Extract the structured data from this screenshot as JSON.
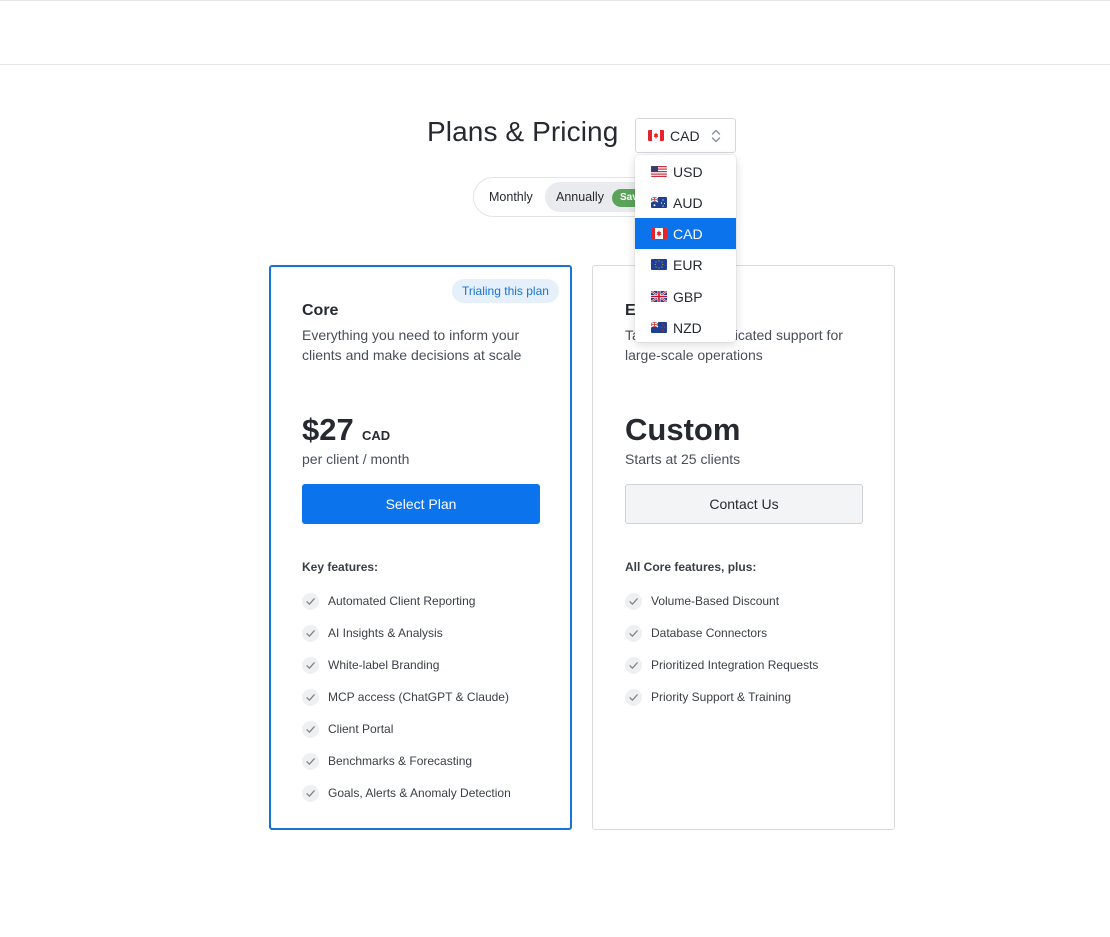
{
  "header": {
    "title": "Plans & Pricing"
  },
  "currency": {
    "selected": "CAD",
    "options": [
      "USD",
      "AUD",
      "CAD",
      "EUR",
      "GBP",
      "NZD"
    ]
  },
  "billing": {
    "monthly_label": "Monthly",
    "annually_label": "Annually",
    "save_badge": "Save"
  },
  "plans": {
    "core": {
      "badge": "Trialing this plan",
      "name": "Core",
      "description": "Everything you need to inform your clients and make decisions at scale",
      "price": "$27",
      "price_unit": "CAD",
      "price_sub": "per client / month",
      "cta": "Select Plan",
      "features_heading": "Key features:",
      "features": [
        "Automated Client Reporting",
        "AI Insights & Analysis",
        "White-label Branding",
        "MCP access (ChatGPT & Claude)",
        "Client Portal",
        "Benchmarks & Forecasting",
        "Goals, Alerts & Anomaly Detection"
      ]
    },
    "enterprise": {
      "name": "E",
      "description": "Ta           with dedicated support for large-scale operations",
      "price": "Custom",
      "price_sub": "Starts at 25 clients",
      "cta": "Contact Us",
      "features_heading": "All Core features, plus:",
      "features": [
        "Volume-Based Discount",
        "Database Connectors",
        "Prioritized Integration Requests",
        "Priority Support & Training"
      ]
    }
  },
  "colors": {
    "primary": "#0b73ec",
    "card_selected_border": "#1773d6",
    "save_green": "#5ba35a",
    "text": "#262a30"
  },
  "icons": {
    "check": "check-icon",
    "selector": "chevron-updown-icon",
    "flags": [
      "us-flag-icon",
      "au-flag-icon",
      "ca-flag-icon",
      "eu-flag-icon",
      "gb-flag-icon",
      "nz-flag-icon"
    ]
  }
}
